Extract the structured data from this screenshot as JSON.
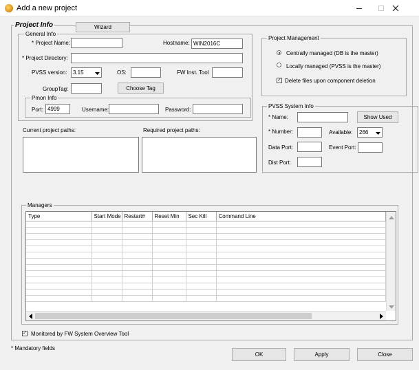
{
  "window": {
    "title": "Add a new project"
  },
  "project_info": {
    "title": "Project Info",
    "wizard_label": "Wizard",
    "general_info": {
      "title": "General Info",
      "project_name_label": "* Project Name:",
      "project_name_value": "",
      "hostname_label": "Hostname:",
      "hostname_value": "WIN2016C",
      "project_directory_label": "* Project Directory:",
      "project_directory_value": "",
      "pvss_version_label": "PVSS version:",
      "pvss_version_value": "3.15",
      "os_label": "OS:",
      "os_value": "",
      "fw_inst_tool_label": "FW Inst. Tool",
      "fw_inst_tool_value": "",
      "group_tag_label": "GroupTag:",
      "group_tag_value": "",
      "choose_tag_label": "Choose Tag",
      "pmon_info": {
        "title": "Pmon Info",
        "port_label": "Port:",
        "port_value": "4999",
        "username_label": "Username:",
        "username_value": "",
        "password_label": "Password:",
        "password_value": ""
      }
    },
    "current_paths_label": "Current project paths:",
    "required_paths_label": "Required project paths:"
  },
  "project_management": {
    "title": "Project Management",
    "option_centrally": "Centrally managed (DB is the master)",
    "option_locally": "Locally managed (PVSS is the master)",
    "selected": "centrally",
    "delete_files_label": "Delete files upon component deletion",
    "delete_files_checked": true
  },
  "pvss_system_info": {
    "title": "PVSS System Info",
    "name_label": "* Name:",
    "name_value": "",
    "show_used_label": "Show Used",
    "number_label": "* Number:",
    "number_value": "",
    "available_label": "Available:",
    "available_value": "266",
    "data_port_label": "Data Port:",
    "data_port_value": "",
    "event_port_label": "Event Port:",
    "event_port_value": "",
    "dist_port_label": "Dist Port:",
    "dist_port_value": ""
  },
  "managers": {
    "title": "Managers",
    "columns": [
      "Type",
      "Start Mode",
      "Restart#",
      "Reset Min",
      "Sec Kill",
      "Command Line"
    ]
  },
  "monitored_label": "Monitored by FW System Overview Tool",
  "monitored_checked": true,
  "mandatory_note": "* Mandatory fields",
  "buttons": {
    "ok": "OK",
    "apply": "Apply",
    "close": "Close"
  }
}
